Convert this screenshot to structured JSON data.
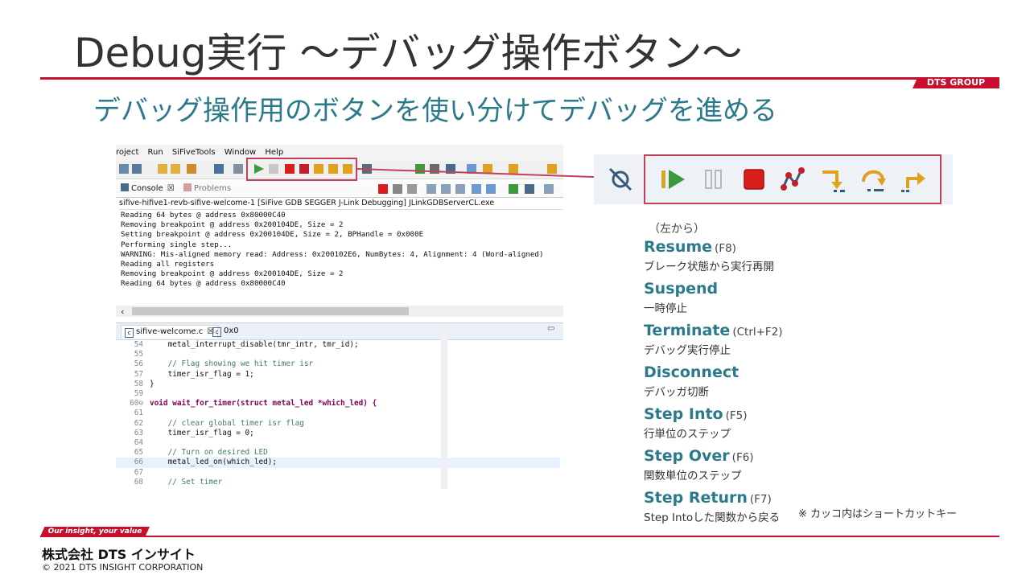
{
  "title": "Debug実行 ～デバッグ操作ボタン～",
  "group_tag": "DTS GROUP",
  "subtitle": "デバッグ操作用のボタンを使い分けてデバッグを進める",
  "ide": {
    "menu": [
      "roject",
      "Run",
      "SiFiveTools",
      "Window",
      "Help"
    ],
    "console_tab": "Console",
    "problems_tab": "Problems",
    "console_title": "sifive-hifive1-revb-sifive-welcome-1 [SiFive GDB SEGGER J-Link Debugging] JLinkGDBServerCL.exe",
    "console_lines": [
      "Reading 64 bytes @ address 0x80000C40",
      "Removing breakpoint @ address 0x200104DE, Size = 2",
      "Setting breakpoint @ address 0x200104DE, Size = 2, BPHandle = 0x000E",
      "Performing single step...",
      "WARNING: Mis-aligned memory read: Address: 0x200102E6, NumBytes: 4, Alignment: 4 (Word-aligned)",
      "Reading all registers",
      "Removing breakpoint @ address 0x200104DE, Size = 2",
      "Reading 64 bytes @ address 0x80000C40"
    ],
    "editor_tab1": "sifive-welcome.c",
    "editor_tab2": "0x0",
    "code_lines": [
      {
        "n": "54",
        "t": "    metal_interrupt_disable(tmr_intr, tmr_id);"
      },
      {
        "n": "55",
        "t": ""
      },
      {
        "n": "56",
        "t": "    // Flag showing we hit timer isr"
      },
      {
        "n": "57",
        "t": "    timer_isr_flag = 1;"
      },
      {
        "n": "58",
        "t": "}"
      },
      {
        "n": "59",
        "t": ""
      },
      {
        "n": "60⊖",
        "t": "void wait_for_timer(struct metal_led *which_led) {"
      },
      {
        "n": "61",
        "t": ""
      },
      {
        "n": "62",
        "t": "    // clear global timer isr flag"
      },
      {
        "n": "63",
        "t": "    timer_isr_flag = 0;"
      },
      {
        "n": "64",
        "t": ""
      },
      {
        "n": "65",
        "t": "    // Turn on desired LED"
      },
      {
        "n": "66",
        "t": "    metal_led_on(which_led);"
      },
      {
        "n": "67",
        "t": ""
      },
      {
        "n": "68",
        "t": "    // Set timer"
      }
    ]
  },
  "buttons_note": "（左から）",
  "buttons": [
    {
      "name": "Resume",
      "key": "(F8)",
      "desc": "ブレーク状態から実行再開",
      "icon": "resume-icon",
      "color": "#3c9a3c"
    },
    {
      "name": "Suspend",
      "key": "",
      "desc": "一時停止",
      "icon": "suspend-icon",
      "color": "#b8b8b8"
    },
    {
      "name": "Terminate",
      "key": "(Ctrl+F2)",
      "desc": "デバッグ実行停止",
      "icon": "terminate-icon",
      "color": "#d91e1e"
    },
    {
      "name": "Disconnect",
      "key": "",
      "desc": "デバッガ切断",
      "icon": "disconnect-icon",
      "color": "#c0202a"
    },
    {
      "name": "Step Into",
      "key": "(F5)",
      "desc": "行単位のステップ",
      "icon": "step-into-icon",
      "color": "#e0a020"
    },
    {
      "name": "Step Over",
      "key": "(F6)",
      "desc": "関数単位のステップ",
      "icon": "step-over-icon",
      "color": "#e0a020"
    },
    {
      "name": "Step Return",
      "key": "(F7)",
      "desc": "Step Intoした関数から戻る",
      "icon": "step-return-icon",
      "color": "#e0a020"
    }
  ],
  "shortcut_note": "※ カッコ内はショートカットキー",
  "footer": {
    "tagline": "Our insight, your value",
    "company": "株式会社 DTS インサイト",
    "copyright": "© 2021 DTS INSIGHT CORPORATION"
  },
  "accent_color": "#c8102e",
  "teal_color": "#2a7a8c"
}
